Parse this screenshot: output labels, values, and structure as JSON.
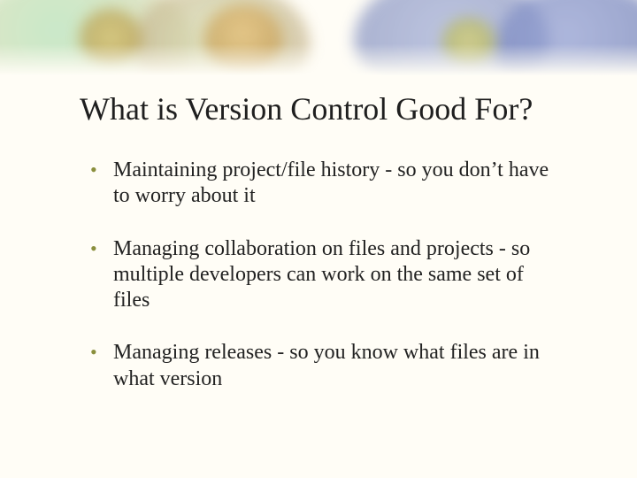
{
  "slide": {
    "title": "What is Version Control Good For?",
    "bullets": [
      "Maintaining project/file history - so you don’t have to worry about it",
      "Managing collaboration on files and projects - so multiple developers can work on the same set of files",
      "Managing releases - so you know what files are in what version"
    ]
  }
}
